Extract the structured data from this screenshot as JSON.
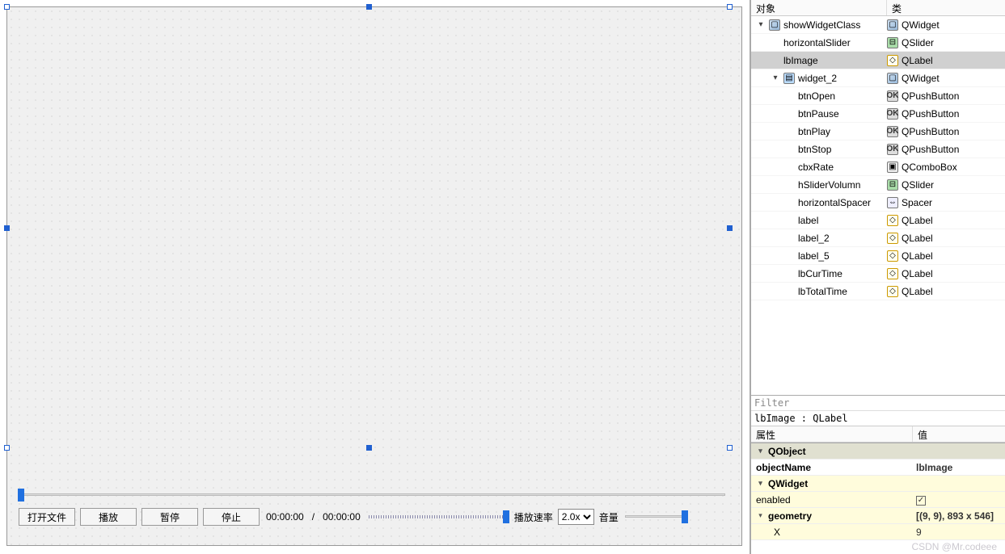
{
  "tree": {
    "header_obj": "对象",
    "header_cls": "类",
    "nodes": [
      {
        "name": "showWidgetClass",
        "cls": "QWidget",
        "depth": 0,
        "expander": "▾",
        "iconObj": "ic-widget",
        "iconCls": "ic-widget",
        "selected": false
      },
      {
        "name": "horizontalSlider",
        "cls": "QSlider",
        "depth": 1,
        "expander": "",
        "iconObj": "",
        "iconCls": "ic-slider",
        "selected": false
      },
      {
        "name": "lbImage",
        "cls": "QLabel",
        "depth": 1,
        "expander": "",
        "iconObj": "",
        "iconCls": "ic-label-tag",
        "selected": true
      },
      {
        "name": "widget_2",
        "cls": "QWidget",
        "depth": 1,
        "expander": "▾",
        "iconObj": "ic-stack",
        "iconCls": "ic-widget",
        "selected": false
      },
      {
        "name": "btnOpen",
        "cls": "QPushButton",
        "depth": 2,
        "expander": "",
        "iconObj": "",
        "iconCls": "ic-button",
        "selected": false
      },
      {
        "name": "btnPause",
        "cls": "QPushButton",
        "depth": 2,
        "expander": "",
        "iconObj": "",
        "iconCls": "ic-button",
        "selected": false
      },
      {
        "name": "btnPlay",
        "cls": "QPushButton",
        "depth": 2,
        "expander": "",
        "iconObj": "",
        "iconCls": "ic-button",
        "selected": false
      },
      {
        "name": "btnStop",
        "cls": "QPushButton",
        "depth": 2,
        "expander": "",
        "iconObj": "",
        "iconCls": "ic-button",
        "selected": false
      },
      {
        "name": "cbxRate",
        "cls": "QComboBox",
        "depth": 2,
        "expander": "",
        "iconObj": "",
        "iconCls": "ic-combo",
        "selected": false
      },
      {
        "name": "hSliderVolumn",
        "cls": "QSlider",
        "depth": 2,
        "expander": "",
        "iconObj": "",
        "iconCls": "ic-slider",
        "selected": false
      },
      {
        "name": "horizontalSpacer",
        "cls": "Spacer",
        "depth": 2,
        "expander": "",
        "iconObj": "",
        "iconCls": "ic-spacer",
        "selected": false
      },
      {
        "name": "label",
        "cls": "QLabel",
        "depth": 2,
        "expander": "",
        "iconObj": "",
        "iconCls": "ic-label-tag",
        "selected": false
      },
      {
        "name": "label_2",
        "cls": "QLabel",
        "depth": 2,
        "expander": "",
        "iconObj": "",
        "iconCls": "ic-label-tag",
        "selected": false
      },
      {
        "name": "label_5",
        "cls": "QLabel",
        "depth": 2,
        "expander": "",
        "iconObj": "",
        "iconCls": "ic-label-tag",
        "selected": false
      },
      {
        "name": "lbCurTime",
        "cls": "QLabel",
        "depth": 2,
        "expander": "",
        "iconObj": "",
        "iconCls": "ic-label-tag",
        "selected": false
      },
      {
        "name": "lbTotalTime",
        "cls": "QLabel",
        "depth": 2,
        "expander": "",
        "iconObj": "",
        "iconCls": "ic-label-tag",
        "selected": false
      }
    ]
  },
  "controls": {
    "btnOpen": "打开文件",
    "btnPlay": "播放",
    "btnPause": "暂停",
    "btnStop": "停止",
    "curTime": "00:00:00",
    "sep": " / ",
    "totalTime": "00:00:00",
    "rateLabel": "播放速率",
    "rateValue": "2.0x",
    "volLabel": "音量"
  },
  "filter": {
    "placeholder": "Filter",
    "classinfo": "lbImage : QLabel"
  },
  "properties": {
    "header_name": "属性",
    "header_val": "值",
    "rows": [
      {
        "type": "group",
        "name": "QObject",
        "val": "",
        "expander": "▾"
      },
      {
        "type": "prop",
        "name": "objectName",
        "val": "lbImage",
        "bold": true
      },
      {
        "type": "group",
        "name": "QWidget",
        "val": "",
        "expander": "▾",
        "yellow": true
      },
      {
        "type": "prop",
        "name": "enabled",
        "val": "check",
        "yellow": true
      },
      {
        "type": "prop",
        "name": "geometry",
        "val": "[(9, 9), 893 x 546]",
        "expander": "▾",
        "yellow": true,
        "bold": true
      },
      {
        "type": "prop",
        "name": "X",
        "val": "9",
        "yellow": true,
        "indent": true
      }
    ]
  },
  "watermark": "CSDN @Mr.codeee"
}
